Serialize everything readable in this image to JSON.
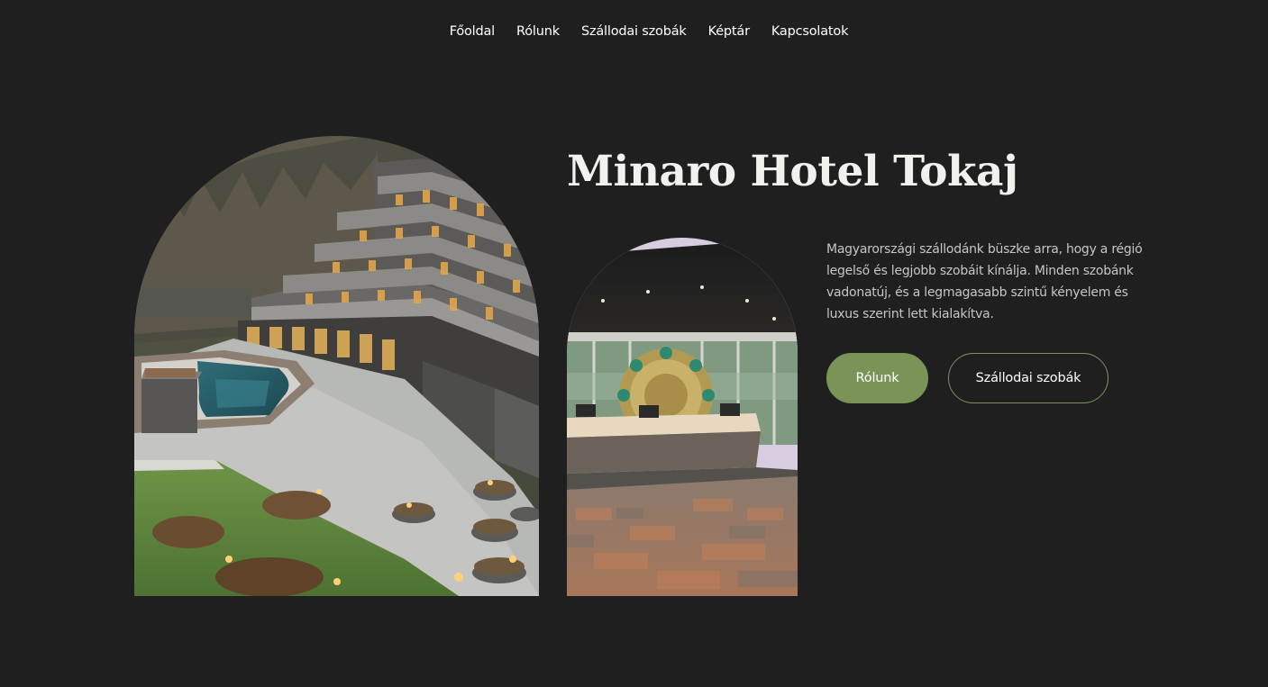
{
  "nav": {
    "items": [
      {
        "label": "Főoldal"
      },
      {
        "label": "Rólunk"
      },
      {
        "label": "Szállodai szobák"
      },
      {
        "label": "Képtár"
      },
      {
        "label": "Kapcsolatok"
      }
    ]
  },
  "hero": {
    "title": "Minaro Hotel Tokaj",
    "description": "Magyarországi szállodánk büszke arra, hogy a régió legelső és legjobb szobáit kínálja. Minden szobánk vadonatúj, és a legmagasabb szintű kényelem és luxus szerint lett kialakítva.",
    "primary_button": "Rólunk",
    "secondary_button": "Szállodai szobák"
  },
  "colors": {
    "background": "#201f20",
    "accent": "#7a9458",
    "text": "#ffffff",
    "muted_text": "#c9c6c1"
  }
}
